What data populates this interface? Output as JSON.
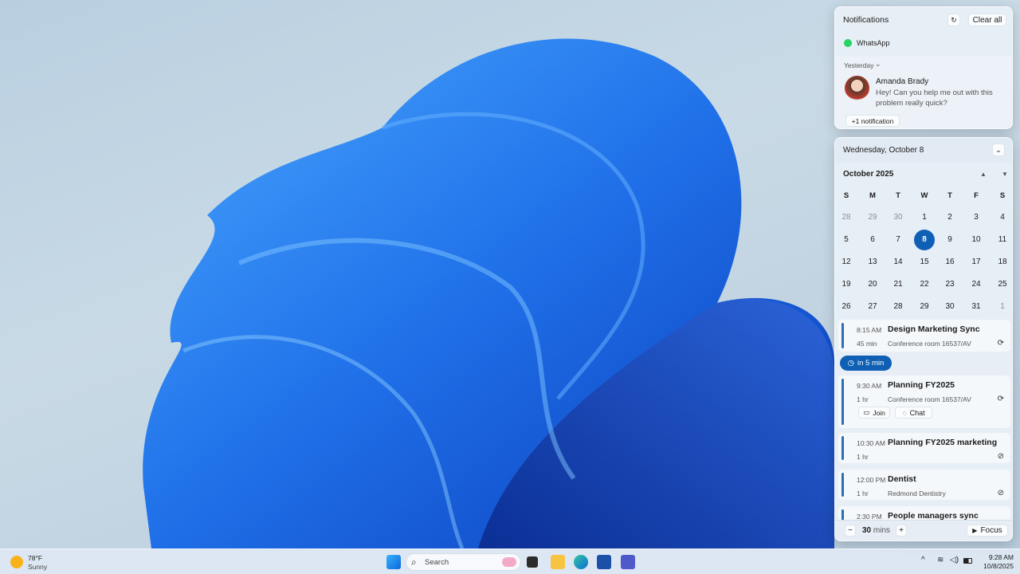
{
  "notifications": {
    "title": "Notifications",
    "clear_all": "Clear all",
    "app": "WhatsApp",
    "group_label": "Yesterday",
    "sender": "Amanda Brady",
    "message": "Hey! Can you help me out with this problem really quick?",
    "more": "+1 notification"
  },
  "calendar": {
    "date_header": "Wednesday, October 8",
    "month": "October 2025",
    "weekdays": [
      "S",
      "M",
      "T",
      "W",
      "T",
      "F",
      "S"
    ],
    "weeks": [
      [
        "28",
        "29",
        "30",
        "1",
        "2",
        "3",
        "4"
      ],
      [
        "5",
        "6",
        "7",
        "8",
        "9",
        "10",
        "11"
      ],
      [
        "12",
        "13",
        "14",
        "15",
        "16",
        "17",
        "18"
      ],
      [
        "19",
        "20",
        "21",
        "22",
        "23",
        "24",
        "25"
      ],
      [
        "26",
        "27",
        "28",
        "29",
        "30",
        "31",
        "1"
      ]
    ],
    "today": "8",
    "accent": "#0f5fb5"
  },
  "events": [
    {
      "time": "8:15 AM",
      "title": "Design Marketing Sync",
      "duration": "45 min",
      "location": "Conference room 16537/AV",
      "icon": "recurring-icon"
    },
    {
      "time": "9:30 AM",
      "title": "Planning FY2025",
      "duration": "1 hr",
      "location": "Conference room 16537/AV",
      "icon": "recurring-icon",
      "join": "Join",
      "chat": "Chat"
    },
    {
      "time": "10:30 AM",
      "title": "Planning FY2025 marketing",
      "duration": "1 hr",
      "location": "",
      "icon": "recurring-off-icon"
    },
    {
      "time": "12:00 PM",
      "title": "Dentist",
      "duration": "1 hr",
      "location": "Redmond Dentistry",
      "icon": "recurring-off-icon"
    },
    {
      "time": "2:30 PM",
      "title": "People managers sync"
    }
  ],
  "upcoming_pill": "in 5 min",
  "focus": {
    "minutes": "30",
    "unit": "mins",
    "label": "Focus"
  },
  "taskbar": {
    "temp": "78°F",
    "condition": "Sunny",
    "search_placeholder": "Search",
    "time": "9:28 AM",
    "date": "10/8/2025"
  }
}
